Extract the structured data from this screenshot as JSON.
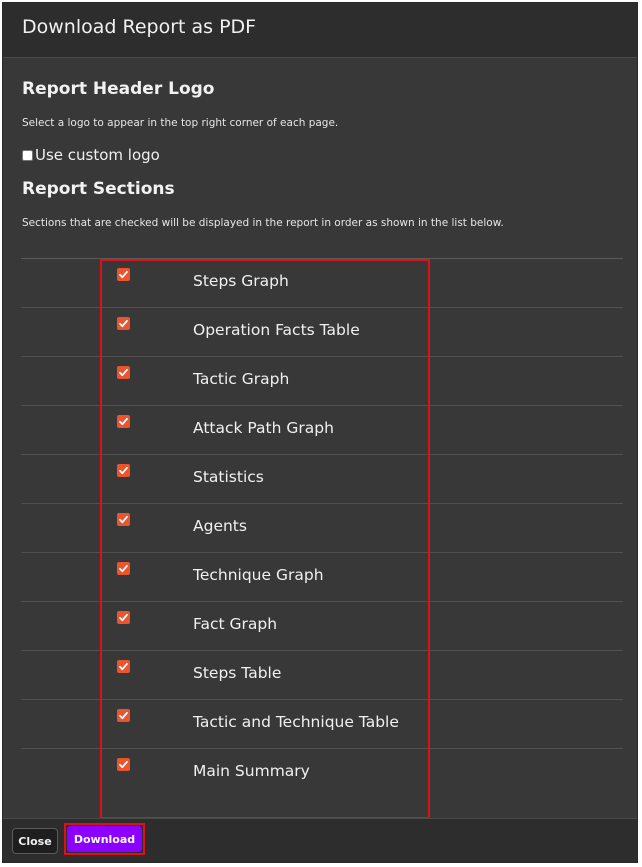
{
  "modal": {
    "title": "Download Report as PDF"
  },
  "logo_section": {
    "title": "Report Header Logo",
    "help": "Select a logo to appear in the top right corner of each page.",
    "custom_logo_label": "Use custom logo",
    "custom_logo_checked": false
  },
  "sections": {
    "title": "Report Sections",
    "help": "Sections that are checked will be displayed in the report in order as shown in the list below.",
    "items": [
      {
        "label": "Steps Graph",
        "checked": true
      },
      {
        "label": "Operation Facts Table",
        "checked": true
      },
      {
        "label": "Tactic Graph",
        "checked": true
      },
      {
        "label": "Attack Path Graph",
        "checked": true
      },
      {
        "label": "Statistics",
        "checked": true
      },
      {
        "label": "Agents",
        "checked": true
      },
      {
        "label": "Technique Graph",
        "checked": true
      },
      {
        "label": "Fact Graph",
        "checked": true
      },
      {
        "label": "Steps Table",
        "checked": true
      },
      {
        "label": "Tactic and Technique Table",
        "checked": true
      },
      {
        "label": "Main Summary",
        "checked": true
      }
    ]
  },
  "footer": {
    "close_label": "Close",
    "download_label": "Download"
  },
  "colors": {
    "checkbox_accent": "#e9552f",
    "download_button": "#8b00ff",
    "highlight": "#e0101a"
  }
}
